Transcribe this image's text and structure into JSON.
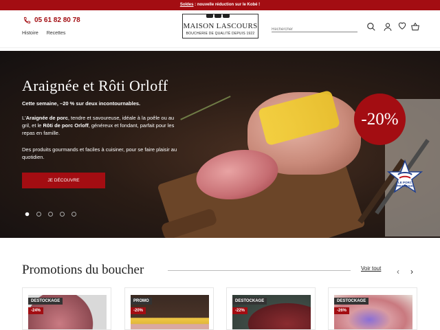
{
  "topbar": {
    "link_text": "Soldes",
    "rest_text": " : nouvelle réduction sur le Kobé !"
  },
  "header": {
    "phone": "05 61 82 80 78",
    "nav": [
      "Histoire",
      "Recettes"
    ],
    "logo_name": "MAISON LASCOURS",
    "logo_sub": "BOUCHERIE DE QUALITÉ DEPUIS 1922",
    "search_placeholder": "Rechercher",
    "icons": [
      "search-icon",
      "user-icon",
      "heart-icon",
      "basket-icon"
    ]
  },
  "hero": {
    "title": "Araignée et Rôti Orloff",
    "subtitle": "Cette semaine, –20 % sur deux incontournables.",
    "para1_a": "L'",
    "para1_b": "Araignée de porc",
    "para1_c": ", tendre et savoureuse, idéale à la poêle ou au gril, et le ",
    "para1_d": "Rôti de porc Orloff",
    "para1_e": ", généreux et fondant, parfait pour les repas en famille.",
    "para2": "Des produits gourmands et faciles à cuisiner, pour se faire plaisir au quotidien.",
    "cta": "JE DÉCOUVRE",
    "badge": "-20%",
    "porc_label_1": "LE PORC",
    "porc_label_2": "FRANÇAIS",
    "slide_count": 5,
    "active_slide": 1
  },
  "promotions": {
    "title": "Promotions du boucher",
    "see_all": "Voir tout",
    "prev": "‹",
    "next": "›",
    "cards": [
      {
        "tag": "DESTOCKAGE",
        "discount": "-24%"
      },
      {
        "tag": "PROMO",
        "discount": "-20%"
      },
      {
        "tag": "DESTOCKAGE",
        "discount": "-22%"
      },
      {
        "tag": "DESTOCKAGE",
        "discount": "-26%"
      }
    ]
  },
  "colors": {
    "brand_red": "#a30d12",
    "dark": "#222222"
  }
}
